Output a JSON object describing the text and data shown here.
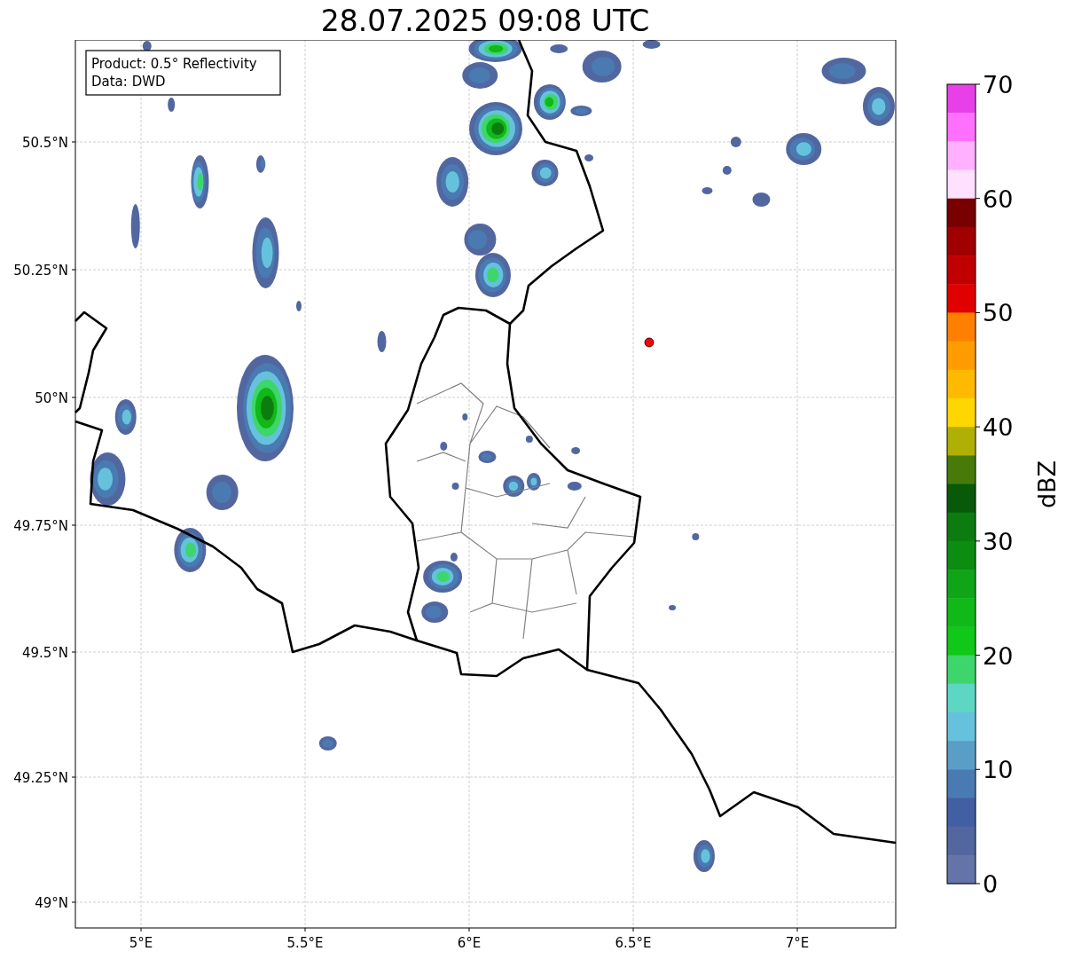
{
  "title": "28.07.2025 09:08 UTC",
  "info_box": [
    "Product: 0.5° Reflectivity",
    "Data: DWD"
  ],
  "map": {
    "x_ticks": [
      "5°E",
      "5.5°E",
      "6°E",
      "6.5°E",
      "7°E"
    ],
    "y_ticks": [
      "50.5°N",
      "50.25°N",
      "50°N",
      "49.75°N",
      "49.5°N",
      "49.25°N",
      "49°N"
    ]
  },
  "colorbar": {
    "label": "dBZ",
    "ticks": [
      "70",
      "60",
      "50",
      "40",
      "30",
      "20",
      "10",
      "0"
    ],
    "segments": [
      {
        "color": "#e840e8"
      },
      {
        "color": "#ff70ff"
      },
      {
        "color": "#ffb0ff"
      },
      {
        "color": "#ffe0ff"
      },
      {
        "color": "#780000"
      },
      {
        "color": "#a00000"
      },
      {
        "color": "#c00000"
      },
      {
        "color": "#e00000"
      },
      {
        "color": "#ff7f00"
      },
      {
        "color": "#ff9c00"
      },
      {
        "color": "#ffba00"
      },
      {
        "color": "#ffd700"
      },
      {
        "color": "#b0b004"
      },
      {
        "color": "#487a0a"
      },
      {
        "color": "#085a0a"
      },
      {
        "color": "#0c7c10"
      },
      {
        "color": "#0c8c10"
      },
      {
        "color": "#10a518"
      },
      {
        "color": "#10b818"
      },
      {
        "color": "#10c818"
      },
      {
        "color": "#3ed66c"
      },
      {
        "color": "#5ed6c4"
      },
      {
        "color": "#66c2dc"
      },
      {
        "color": "#5a9ec8"
      },
      {
        "color": "#4a7ab2"
      },
      {
        "color": "#435fa3"
      },
      {
        "color": "#52679f"
      },
      {
        "color": "#6474a8"
      }
    ]
  }
}
